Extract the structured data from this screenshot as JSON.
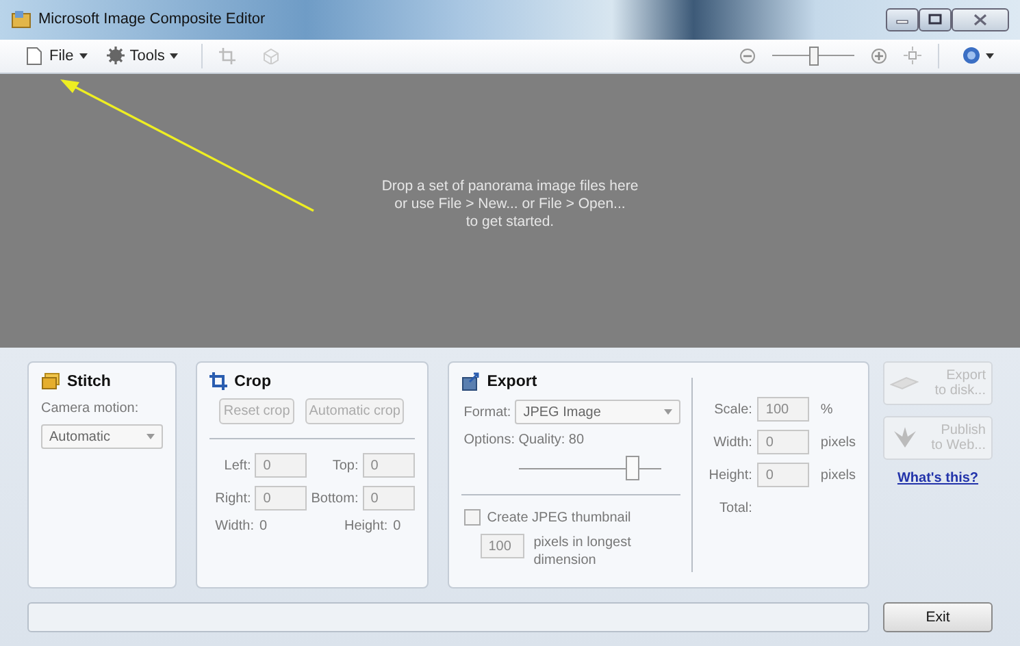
{
  "window": {
    "title": "Microsoft Image Composite Editor"
  },
  "toolbar": {
    "menus": [
      {
        "label": "File",
        "kind": "file"
      },
      {
        "label": "Tools",
        "kind": "tools"
      }
    ],
    "zoom": {
      "level": 0.5
    }
  },
  "canvas": {
    "message": [
      "Drop a set of panorama image files here",
      "or use File > New... or File > Open...",
      "to get started."
    ]
  },
  "pointer_arrow": true,
  "stitch": {
    "title": "Stitch",
    "camera_motion_label": "Camera motion:",
    "camera_motion_value": "Automatic"
  },
  "crop": {
    "title": "Crop",
    "buttons": [
      {
        "label": "Reset crop",
        "disabled": true
      },
      {
        "label": "Automatic crop",
        "disabled": true
      }
    ],
    "fields": [
      {
        "label": "Left:",
        "value": "0"
      },
      {
        "label": "Top:",
        "value": "0"
      },
      {
        "label": "Right:",
        "value": "0"
      },
      {
        "label": "Bottom:",
        "value": "0"
      }
    ],
    "readouts": [
      {
        "label": "Width:",
        "value": "0"
      },
      {
        "label": "Height:",
        "value": "0"
      }
    ]
  },
  "export": {
    "title": "Export",
    "format_label": "Format:",
    "format_value": "JPEG Image",
    "options_label": "Options: Quality: 80",
    "quality": {
      "level": 0.8
    },
    "thumbnail": {
      "label": "Create JPEG thumbnail",
      "checked": false
    },
    "thumbnail_size": "100",
    "thumbnail_size_label": "pixels in longest dimension",
    "size_fields": [
      {
        "label": "Scale:",
        "value": "100",
        "unit": "%"
      },
      {
        "label": "Width:",
        "value": "0",
        "unit": "pixels"
      },
      {
        "label": "Height:",
        "value": "0",
        "unit": "pixels"
      }
    ],
    "total_label": "Total:"
  },
  "actions": [
    {
      "label": "Export to disk...",
      "kind": "disk",
      "disabled": true
    },
    {
      "label": "Publish to Web...",
      "kind": "web",
      "disabled": true
    }
  ],
  "help_link": "What's this?",
  "exit_button": "Exit"
}
